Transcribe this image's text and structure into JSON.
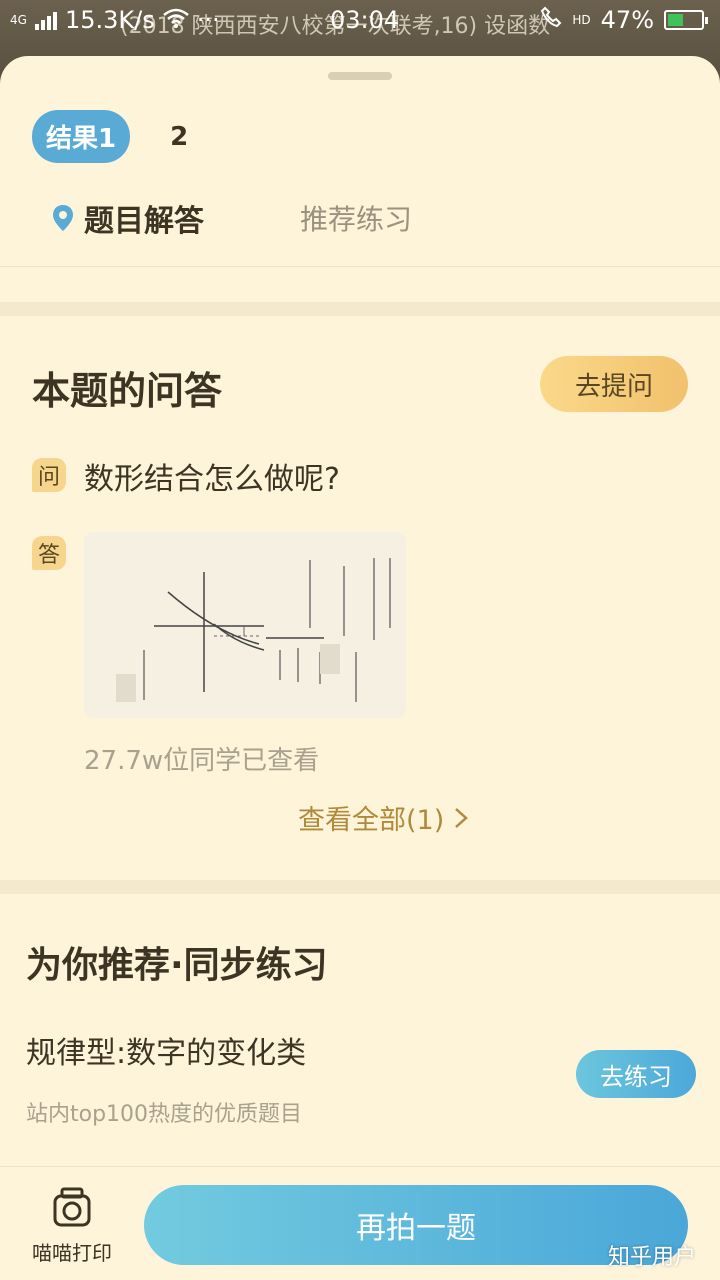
{
  "status_bar": {
    "network": "4G",
    "speed": "15.3K/s",
    "more": "···",
    "time": "03:04",
    "hd": "HD",
    "battery": "47%",
    "battery_level": 0.47
  },
  "backdrop_text": "(2018 陕西西安八校第一次联考,16) 设函数",
  "result_tabs": [
    "结果1",
    "2"
  ],
  "section_tabs": {
    "active": "题目解答",
    "inactive": "推荐练习"
  },
  "qa": {
    "title": "本题的问答",
    "ask_button": "去提问",
    "question_badge": "问",
    "question": "数形结合怎么做呢?",
    "answer_badge": "答",
    "views": "27.7w位同学已查看",
    "see_all": "查看全部(1)"
  },
  "recommend": {
    "title": "为你推荐·同步练习",
    "item_title": "规律型:数字的变化类",
    "item_sub": "站内top100热度的优质题目",
    "practice_button": "去练习"
  },
  "bottom": {
    "print_label": "喵喵打印",
    "retake_button": "再拍一题",
    "watermark": "知乎用户"
  },
  "colors": {
    "sheet_bg": "#fdf4da",
    "accent_blue": "#4aa7d8",
    "accent_gold": "#f2c16c",
    "text_dark": "#3d3424"
  }
}
